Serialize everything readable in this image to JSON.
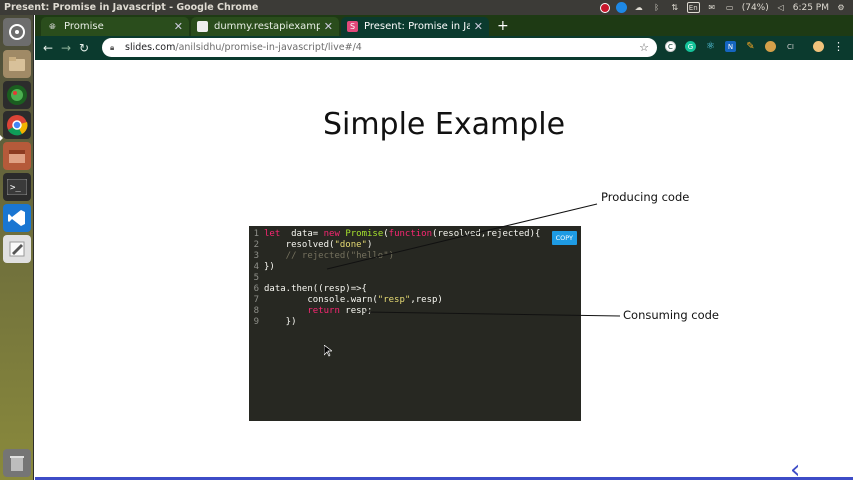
{
  "window_title": "Present: Promise in Javascript - Google Chrome",
  "top_panel": {
    "lang": "En",
    "battery": "(74%)",
    "time": "6:25 PM"
  },
  "tabs": [
    {
      "title": "Promise",
      "favicon": "globe-icon"
    },
    {
      "title": "dummy.restapiexample.co",
      "favicon": "page-icon"
    },
    {
      "title": "Present: Promise in Javas",
      "favicon": "slides-icon"
    }
  ],
  "address_bar": {
    "host": "slides.com",
    "path": "/anilsidhu/promise-in-javascript/live#/4"
  },
  "slide": {
    "title": "Simple Example",
    "copy_label": "COPY",
    "callout_top": "Producing code",
    "callout_bottom": "Consuming code"
  },
  "code_lines": [
    {
      "n": "1",
      "tokens": [
        [
          "kw",
          "let"
        ],
        [
          "",
          "  data= "
        ],
        [
          "kw",
          "new"
        ],
        [
          "",
          " "
        ],
        [
          "fn",
          "Promise"
        ],
        [
          "",
          "("
        ],
        [
          "kw",
          "function"
        ],
        [
          "",
          "(resolved,rejected){"
        ]
      ]
    },
    {
      "n": "2",
      "tokens": [
        [
          "",
          "    resolved("
        ],
        [
          "str",
          "\"done\""
        ],
        [
          "",
          ")"
        ]
      ]
    },
    {
      "n": "3",
      "tokens": [
        [
          "cm",
          "    // rejected(\"hello\")"
        ]
      ]
    },
    {
      "n": "4",
      "tokens": [
        [
          "",
          "})"
        ]
      ]
    },
    {
      "n": "5",
      "tokens": [
        [
          "",
          ""
        ]
      ]
    },
    {
      "n": "6",
      "tokens": [
        [
          "",
          "data.then((resp)=>{"
        ]
      ]
    },
    {
      "n": "7",
      "tokens": [
        [
          "",
          "        console.warn("
        ],
        [
          "str",
          "\"resp\""
        ],
        [
          "",
          ",resp)"
        ]
      ]
    },
    {
      "n": "8",
      "tokens": [
        [
          "kw",
          "        return"
        ],
        [
          "",
          " resp;"
        ]
      ]
    },
    {
      "n": "9",
      "tokens": [
        [
          "",
          "    })"
        ]
      ]
    }
  ],
  "colors": {
    "tabbar": "#1e3a14",
    "toolbar": "#0b3a2e",
    "code_bg": "#272822",
    "accent": "#3d4cc7"
  }
}
